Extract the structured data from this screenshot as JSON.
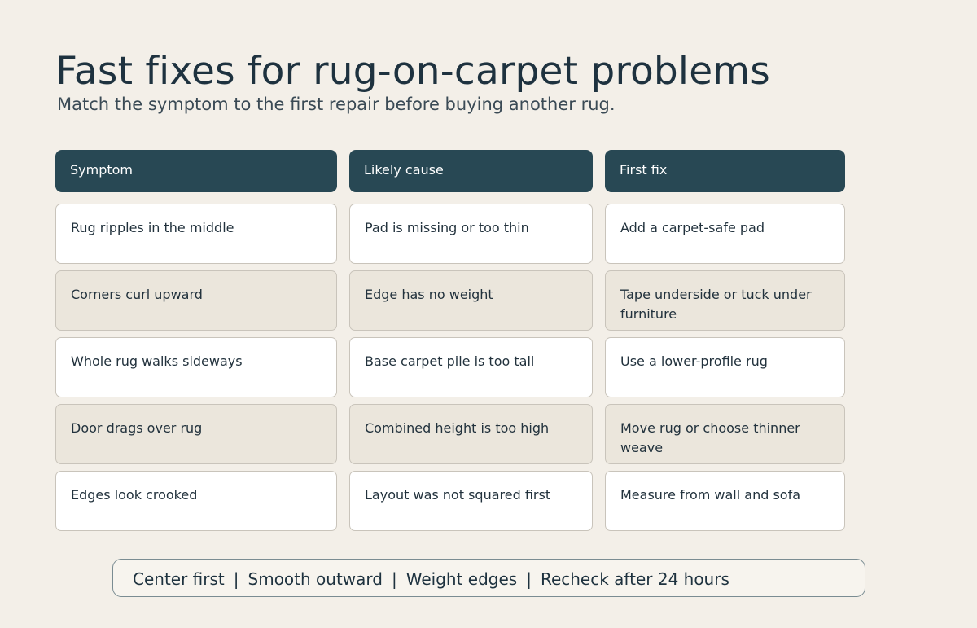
{
  "title": "Fast fixes for rug-on-carpet problems",
  "subtitle": "Match the symptom to the first repair before buying another rug.",
  "table": {
    "headers": [
      "Symptom",
      "Likely cause",
      "First fix"
    ],
    "rows": [
      [
        "Rug ripples in the middle",
        "Pad is missing or too thin",
        "Add a carpet-safe pad"
      ],
      [
        "Corners curl upward",
        "Edge has no weight",
        "Tape underside or tuck under furniture"
      ],
      [
        "Whole rug walks sideways",
        "Base carpet pile is too tall",
        "Use a lower-profile rug"
      ],
      [
        "Door drags over rug",
        "Combined height is too high",
        "Move rug or choose thinner weave"
      ],
      [
        "Edges look crooked",
        "Layout was not squared first",
        "Measure from wall and sofa"
      ]
    ]
  },
  "footer": {
    "steps": [
      "Center first",
      "Smooth outward",
      "Weight edges",
      "Recheck after 24 hours"
    ],
    "separator": "|"
  },
  "colors": {
    "header_bg": "#284854",
    "row_white": "#ffffff",
    "row_beige": "#ebe6dc",
    "page_bg": "#f3efe8"
  }
}
